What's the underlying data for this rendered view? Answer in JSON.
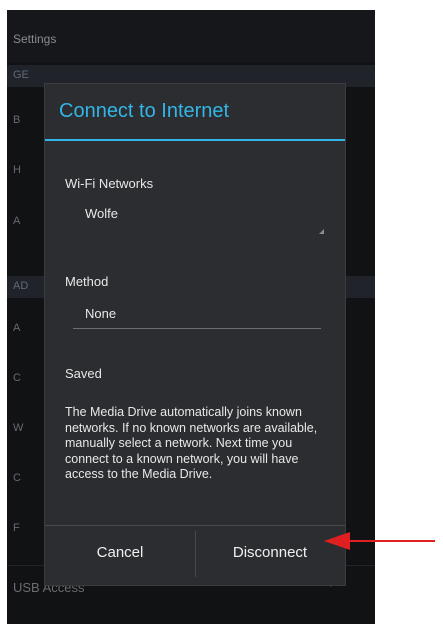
{
  "settings_title": "Settings",
  "sections": {
    "general": "GE",
    "advanced": "AD"
  },
  "fragments": [
    "B",
    "H",
    "A",
    "A",
    "C",
    "W",
    "C",
    "F"
  ],
  "usb_access": "USB Access",
  "dialog": {
    "title": "Connect to Internet",
    "wifi_label": "Wi-Fi Networks",
    "wifi_value": "Wolfe",
    "method_label": "Method",
    "method_value": "None",
    "status": "Saved",
    "message": "The Media Drive automatically joins known networks. If no known networks are available, manually select a network. Next time you connect to a known network, you will have access to the Media Drive.",
    "cancel": "Cancel",
    "disconnect": "Disconnect"
  },
  "colors": {
    "accent": "#33b5e5",
    "arrow": "#e02020"
  }
}
